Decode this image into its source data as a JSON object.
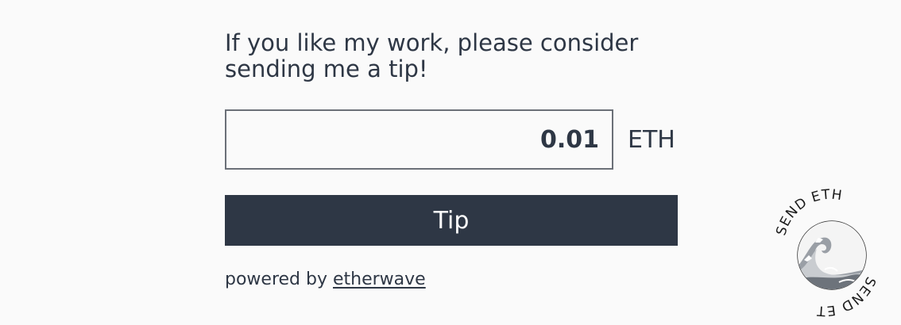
{
  "tip_widget": {
    "message": "If you like my work, please consider sending me a tip!",
    "amount_value": "0.01",
    "currency": "ETH",
    "button_label": "Tip",
    "powered_prefix": "powered by ",
    "powered_link": "etherwave"
  },
  "badge": {
    "text": "SEND ETH",
    "icon": "ocean-wave-icon"
  },
  "colors": {
    "background": "#fafafa",
    "text": "#2e3745",
    "button_bg": "#2e3745",
    "button_text": "#ffffff",
    "input_border": "#6b7078"
  }
}
